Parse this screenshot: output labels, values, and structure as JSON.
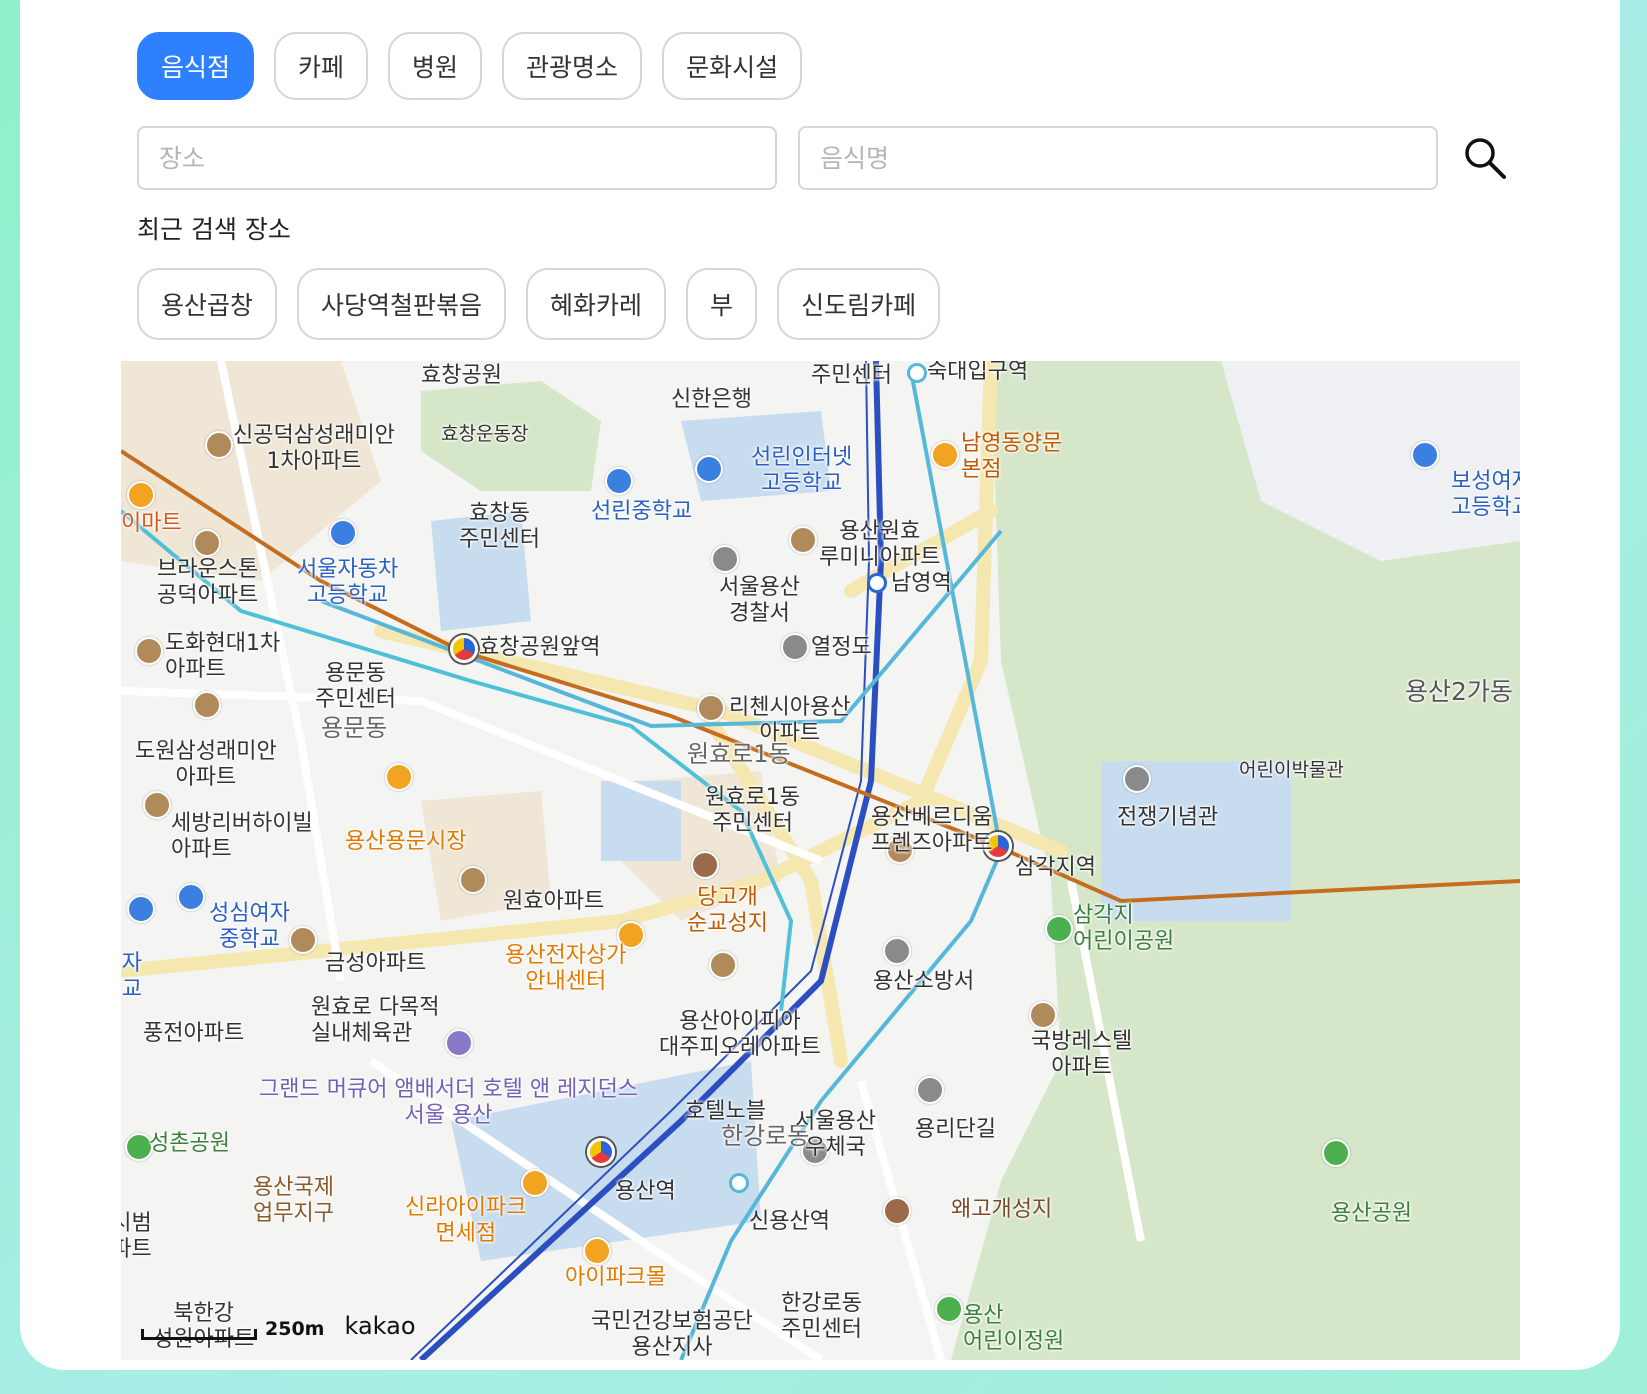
{
  "categories": [
    "음식점",
    "카페",
    "병원",
    "관광명소",
    "문화시설"
  ],
  "search": {
    "place_placeholder": "장소",
    "food_placeholder": "음식명"
  },
  "recent": {
    "title": "최근 검색 장소",
    "items": [
      "용산곱창",
      "사당역철판볶음",
      "혜화카레",
      "부",
      "신도림카페"
    ]
  },
  "map": {
    "labels": {
      "hyochang_park": "효창공원",
      "community_center_top": "주민센터",
      "sookmyung_stn": "숙대입구역",
      "shinhan": "신한은행",
      "sindeok_apt": "신공덕삼성래미안\n1차아파트",
      "hyochang_stadium": "효창운동장",
      "namyoung_restaurant": "남영동양문\n본점",
      "sunrin_internet": "선린인터넷\n고등학교",
      "boseong": "보성여자\n고등학교",
      "emart": "이마트",
      "hyochang_center": "효창동\n주민센터",
      "sunrin_middle": "선린중학교",
      "yongsan_wonhyo": "용산원효\n루미니아파트",
      "brownstone": "브라운스톤\n공덕아파트",
      "seoul_auto": "서울자동차\n고등학교",
      "yongsan_police": "서울용산\n경찰서",
      "namyoung_stn": "남영역",
      "dohwa": "도화현대1차\n아파트",
      "hyochang_stn": "효창공원앞역",
      "yeoljeongdo": "열정도",
      "yongsan2ga": "용산2가동",
      "yongmun_center": "용문동\n주민센터",
      "yongmun": "용문동",
      "richensia": "리첸시아용산\n아파트",
      "wonhyoro1": "원효로1동",
      "dowon": "도원삼성래미안\n아파트",
      "wonhyo_center": "원효로1동\n주민센터",
      "kids_museum": "어린이박물관",
      "war_memorial": "전쟁기념관",
      "sebang": "세방리버하이빌\n아파트",
      "yongmun_market": "용산용문시장",
      "berdium": "용산베르디움\n프렌즈아파트",
      "samgakji_stn": "삼각지역",
      "wonhyo_apt": "원효아파트",
      "danggogae": "당고개\n순교성지",
      "seongsim_middle": "성심여자\n중학교",
      "samgakji_park": "삼각지\n어린이공원",
      "seongsim_high": "성심여자\n고등학교",
      "geumseong": "금성아파트",
      "electronics": "용산전자상가\n안내센터",
      "fire_station": "용산소방서",
      "pungjeon": "풍전아파트",
      "gym": "원효로 다목적\n실내체육관",
      "ipark_daeju": "용산아이피아\n대주피오레아파트",
      "defense_rest": "국방레스텔\n아파트",
      "grand_mercure": "그랜드 머큐어 앰배서더 호텔 앤 레지던스\n서울 용산",
      "seongchon": "성촌공원",
      "hotel_novotel": "호텔노블",
      "hangangro": "한강로동",
      "post_office": "서울용산\n우체국",
      "yongridan": "용리단길",
      "intl_district": "용산국제\n업무지구",
      "shilla": "신라아이파크\n면세점",
      "yongsan_stn": "용산역",
      "sinyongsan_stn": "신용산역",
      "waegogae": "왜고개성지",
      "yongsan_park": "용산공원",
      "chasi": "차시범\n아파트",
      "ipark_mall": "아이파크몰",
      "bukhangang": "북한강\n성원아파트",
      "nhis": "국민건강보험공단\n용산지사",
      "hangangro_center": "한강로동\n주민센터",
      "kids_garden": "용산\n어린이정원"
    },
    "scale": "250m",
    "logo": "kakao"
  }
}
